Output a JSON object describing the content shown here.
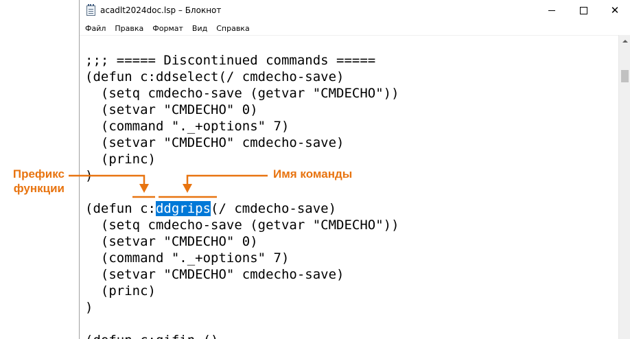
{
  "window": {
    "title": "acadlt2024doc.lsp – Блокнот"
  },
  "menu": {
    "items": [
      "Файл",
      "Правка",
      "Формат",
      "Вид",
      "Справка"
    ]
  },
  "editor": {
    "lines": [
      ";;; ===== Discontinued commands =====",
      "(defun c:ddselect(/ cmdecho-save)",
      "  (setq cmdecho-save (getvar \"CMDECHO\"))",
      "  (setvar \"CMDECHO\" 0)",
      "  (command \"._+options\" 7)",
      "  (setvar \"CMDECHO\" cmdecho-save)",
      "  (princ)",
      ")",
      "",
      "(defun c:ddgrips(/ cmdecho-save)",
      "  (setq cmdecho-save (getvar \"CMDECHO\"))",
      "  (setvar \"CMDECHO\" 0)",
      "  (command \"._+options\" 7)",
      "  (setvar \"CMDECHO\" cmdecho-save)",
      "  (princ)",
      ")",
      "",
      "(defun c:gifin ()"
    ],
    "selected_line": {
      "before": "(defun c:",
      "selected": "ddgrips",
      "after": "(/ cmdecho-save)"
    }
  },
  "annotations": {
    "prefix_label": "Префикс функции",
    "command_label": "Имя команды",
    "color": "#e87410"
  },
  "colors": {
    "selection": "#0078d7",
    "annotation": "#e87410"
  }
}
